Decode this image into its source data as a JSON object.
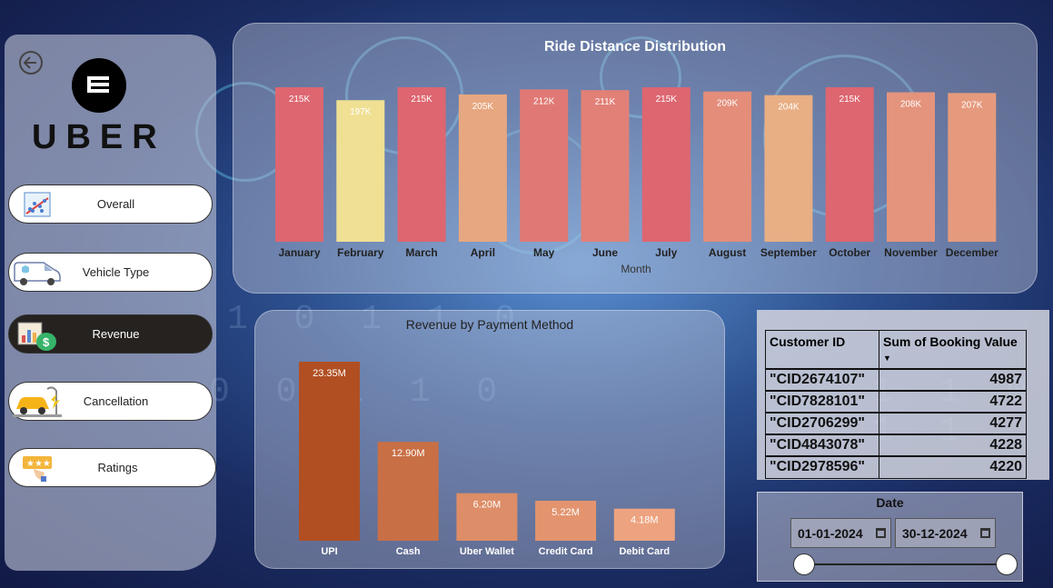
{
  "brand": {
    "name": "UBER"
  },
  "nav": [
    {
      "label": "Overall",
      "icon": "scatter-chart-icon",
      "active": false
    },
    {
      "label": "Vehicle Type",
      "icon": "van-icon",
      "active": false
    },
    {
      "label": "Revenue",
      "icon": "money-bag-chart-icon",
      "active": true
    },
    {
      "label": "Cancellation",
      "icon": "car-charging-icon",
      "active": false
    },
    {
      "label": "Ratings",
      "icon": "stars-rating-icon",
      "active": false
    }
  ],
  "colors": {
    "distance_high": "#dd6670",
    "distance_low": "#f0e094",
    "distance_mid": "#e6a07f",
    "revenue_dark": "#b14f22",
    "revenue_light": "#eda37f"
  },
  "chart_data": [
    {
      "type": "bar",
      "title": "Ride Distance Distribution",
      "xlabel": "Month",
      "ylabel": "",
      "categories": [
        "January",
        "February",
        "March",
        "April",
        "May",
        "June",
        "July",
        "August",
        "September",
        "October",
        "November",
        "December"
      ],
      "values": [
        215,
        197,
        215,
        205,
        212,
        211,
        215,
        209,
        204,
        215,
        208,
        207
      ],
      "value_labels": [
        "215K",
        "197K",
        "215K",
        "205K",
        "212K",
        "211K",
        "215K",
        "209K",
        "204K",
        "215K",
        "208K",
        "207K"
      ],
      "ylim": [
        0,
        215
      ]
    },
    {
      "type": "bar",
      "title": "Revenue by Payment Method",
      "xlabel": "",
      "ylabel": "",
      "categories": [
        "UPI",
        "Cash",
        "Uber Wallet",
        "Credit Card",
        "Debit Card"
      ],
      "values": [
        23.35,
        12.9,
        6.2,
        5.22,
        4.18
      ],
      "value_labels": [
        "23.35M",
        "12.90M",
        "6.20M",
        "5.22M",
        "4.18M"
      ],
      "ylim": [
        0,
        23.35
      ]
    }
  ],
  "table": {
    "headers": [
      "Customer ID",
      "Sum of Booking Value"
    ],
    "sort_indicator": "sort-descending-icon",
    "rows": [
      [
        "\"CID2674107\"",
        "4987"
      ],
      [
        "\"CID7828101\"",
        "4722"
      ],
      [
        "\"CID2706299\"",
        "4277"
      ],
      [
        "\"CID4843078\"",
        "4228"
      ],
      [
        "\"CID2978596\"",
        "4220"
      ]
    ]
  },
  "date_filter": {
    "title": "Date",
    "start": "01-01-2024",
    "end": "30-12-2024"
  },
  "background_text": {
    "line1": "1 0 1 1 0",
    "line2": "0 0 1 1 0",
    "line3": "1 1 0 1 1"
  }
}
